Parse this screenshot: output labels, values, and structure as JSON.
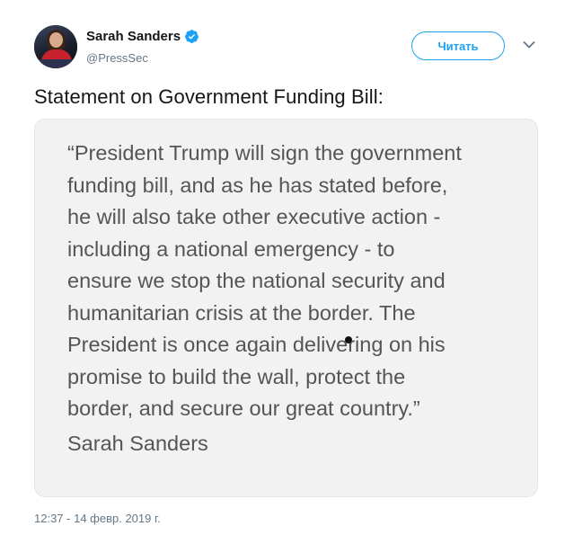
{
  "author": {
    "display_name": "Sarah Sanders",
    "handle": "@PressSec",
    "verified": true
  },
  "follow_button": {
    "label": "Читать"
  },
  "tweet": {
    "text": "Statement on Government Funding Bill:",
    "image_text": "“President Trump will sign the government\nfunding bill, and as he has stated before,\nhe will also take other executive action -\nincluding a national emergency - to\nensure we stop the national security and\nhumanitarian crisis at the border. The\nPresident is once again delivering on his\npromise to build the wall, protect the\nborder, and secure our great country.”",
    "image_signature": "Sarah Sanders",
    "timestamp": "12:37 - 14 февр. 2019 г."
  },
  "colors": {
    "accent": "#1da1f2",
    "secondary_text": "#657786",
    "primary_text": "#14171a"
  },
  "icons": {
    "verified": "verified-badge-icon",
    "more": "chevron-down-icon"
  }
}
